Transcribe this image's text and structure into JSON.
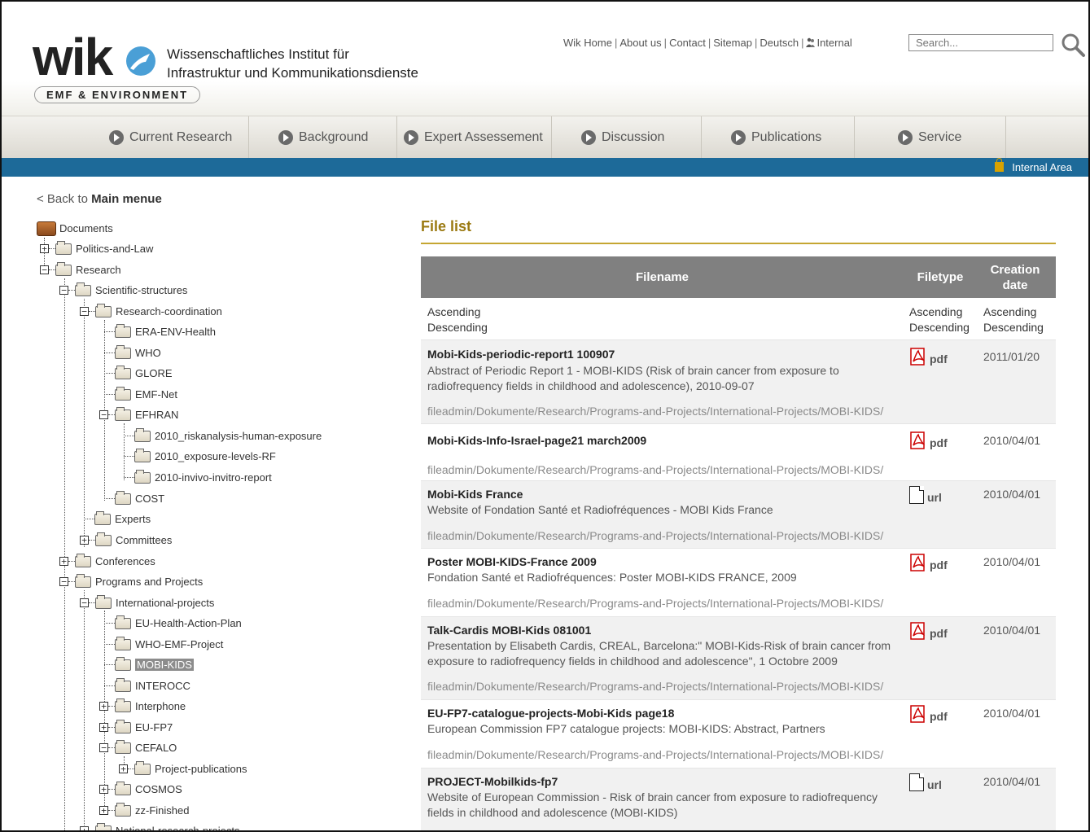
{
  "header": {
    "logo_text": "wik",
    "institute_line1": "Wissenschaftliches Institut für",
    "institute_line2": "Infrastruktur und Kommunikationsdienste",
    "badge": "EMF & ENVIRONMENT",
    "links": [
      "Wik Home",
      "About us",
      "Contact",
      "Sitemap",
      "Deutsch",
      "Internal"
    ],
    "search_placeholder": "Search..."
  },
  "nav": {
    "items": [
      "Current Research",
      "Background",
      "Expert Assessement",
      "Discussion",
      "Publications",
      "Service"
    ],
    "internal_area": "Internal Area"
  },
  "sidebar": {
    "back_prefix": "< Back to ",
    "back_main": "Main menue",
    "tree": [
      {
        "label": "Documents"
      },
      {
        "label": "Politics-and-Law"
      },
      {
        "label": "Research"
      },
      {
        "label": "Scientific-structures"
      },
      {
        "label": "Research-coordination"
      },
      {
        "label": "ERA-ENV-Health"
      },
      {
        "label": "WHO"
      },
      {
        "label": "GLORE"
      },
      {
        "label": "EMF-Net"
      },
      {
        "label": "EFHRAN"
      },
      {
        "label": "2010_riskanalysis-human-exposure"
      },
      {
        "label": "2010_exposure-levels-RF"
      },
      {
        "label": "2010-invivo-invitro-report"
      },
      {
        "label": "COST"
      },
      {
        "label": "Experts"
      },
      {
        "label": "Committees"
      },
      {
        "label": "Conferences"
      },
      {
        "label": "Programs and Projects"
      },
      {
        "label": "International-projects"
      },
      {
        "label": "EU-Health-Action-Plan"
      },
      {
        "label": "WHO-EMF-Project"
      },
      {
        "label": "MOBI-KIDS"
      },
      {
        "label": "INTEROCC"
      },
      {
        "label": "Interphone"
      },
      {
        "label": "EU-FP7"
      },
      {
        "label": "CEFALO"
      },
      {
        "label": "Project-publications"
      },
      {
        "label": "COSMOS"
      },
      {
        "label": "zz-Finished"
      },
      {
        "label": "National-research-projects"
      }
    ]
  },
  "main": {
    "title": "File list",
    "columns": {
      "filename": "Filename",
      "filetype": "Filetype",
      "creation_date": "Creation date"
    },
    "sort": {
      "ascending": "Ascending",
      "descending": "Descending"
    },
    "files": [
      {
        "name": "Mobi-Kids-periodic-report1 100907",
        "description": "Abstract of Periodic Report 1 - MOBI-KIDS (Risk of brain cancer from exposure to radiofrequency fields in childhood and adolescence), 2010-09-07",
        "path": "fileadmin/Dokumente/Research/Programs-and-Projects/International-Projects/MOBI-KIDS/",
        "type": "pdf",
        "date": "2011/01/20"
      },
      {
        "name": "Mobi-Kids-Info-Israel-page21 march2009",
        "description": "",
        "path": "fileadmin/Dokumente/Research/Programs-and-Projects/International-Projects/MOBI-KIDS/",
        "type": "pdf",
        "date": "2010/04/01"
      },
      {
        "name": "Mobi-Kids France",
        "description": "Website of Fondation Santé et Radiofréquences - MOBI Kids France",
        "path": "fileadmin/Dokumente/Research/Programs-and-Projects/International-Projects/MOBI-KIDS/",
        "type": "url",
        "date": "2010/04/01"
      },
      {
        "name": "Poster MOBI-KIDS-France 2009",
        "description": "Fondation Santé et Radiofréquences: Poster MOBI-KIDS FRANCE, 2009",
        "path": "fileadmin/Dokumente/Research/Programs-and-Projects/International-Projects/MOBI-KIDS/",
        "type": "pdf",
        "date": "2010/04/01"
      },
      {
        "name": "Talk-Cardis MOBI-Kids 081001",
        "description": "Presentation by Elisabeth Cardis, CREAL, Barcelona:\" MOBI-Kids-Risk of brain cancer from exposure to radiofrequency fields in childhood and adolescence\", 1 Octobre 2009",
        "path": "fileadmin/Dokumente/Research/Programs-and-Projects/International-Projects/MOBI-KIDS/",
        "type": "pdf",
        "date": "2010/04/01"
      },
      {
        "name": "EU-FP7-catalogue-projects-Mobi-Kids page18",
        "description": "European Commission FP7 catalogue projects: MOBI-KIDS: Abstract, Partners",
        "path": "fileadmin/Dokumente/Research/Programs-and-Projects/International-Projects/MOBI-KIDS/",
        "type": "pdf",
        "date": "2010/04/01"
      },
      {
        "name": "PROJECT-Mobilkids-fp7",
        "description": "Website of European Commission - Risk of brain cancer from exposure to radiofrequency fields in childhood and adolescence (MOBI-KIDS)",
        "path": "",
        "type": "url",
        "date": "2010/04/01"
      }
    ]
  }
}
